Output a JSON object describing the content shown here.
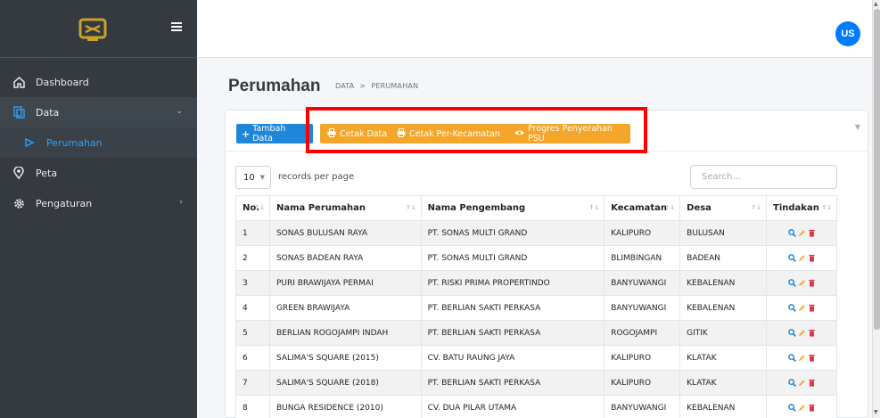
{
  "sidebar": {
    "items": [
      {
        "label": "Dashboard",
        "icon": "home-icon"
      },
      {
        "label": "Data",
        "icon": "database-icon"
      },
      {
        "label": "Perumahan",
        "icon": "circle-icon"
      },
      {
        "label": "Peta",
        "icon": "map-pin-icon"
      },
      {
        "label": "Pengaturan",
        "icon": "gear-icon"
      }
    ]
  },
  "user": {
    "initials": "US"
  },
  "page": {
    "title": "Perumahan",
    "breadcrumb": [
      "DATA",
      "PERUMAHAN"
    ]
  },
  "toolbar": {
    "add_label": "Tambah Data",
    "print_label": "Cetak Data",
    "print_district_label": "Cetak Per-Kecamatan",
    "progress_label": "Progres Penyerahan PSU"
  },
  "datatable": {
    "page_length": "10",
    "length_label": "records per page",
    "search_placeholder": "Search..."
  },
  "table": {
    "headers": [
      "No.",
      "Nama Perumahan",
      "Nama Pengembang",
      "Kecamatan",
      "Desa",
      "Tindakan"
    ],
    "rows": [
      [
        "1",
        "SONAS BULUSAN RAYA",
        "PT. SONAS MULTI GRAND",
        "KALIPURO",
        "BULUSAN"
      ],
      [
        "2",
        "SONAS BADEAN RAYA",
        "PT. SONAS MULTI GRAND",
        "BLIMBINGAN",
        "BADEAN"
      ],
      [
        "3",
        "PURI BRAWIJAYA PERMAI",
        "PT. RISKI PRIMA PROPERTINDO",
        "BANYUWANGI",
        "KEBALENAN"
      ],
      [
        "4",
        "GREEN BRAWIJAYA",
        "PT. BERLIAN SAKTI PERKASA",
        "BANYUWANGI",
        "KEBALENAN"
      ],
      [
        "5",
        "BERLIAN ROGOJAMPI INDAH",
        "PT. BERLIAN SAKTI PERKASA",
        "ROGOJAMPI",
        "GITIK"
      ],
      [
        "6",
        "SALIMA'S SQUARE (2015)",
        "CV. BATU RAUNG JAYA",
        "KALIPURO",
        "KLATAK"
      ],
      [
        "7",
        "SALIMA'S SQUARE (2018)",
        "PT. BERLIAN SAKTI PERKASA",
        "KALIPURO",
        "KLATAK"
      ],
      [
        "8",
        "BUNGA RESIDENCE (2010)",
        "CV. DUA PILAR UTAMA",
        "BANYUWANGI",
        "KEBALENAN"
      ]
    ]
  },
  "colors": {
    "primary": "#1f86d9",
    "warning": "#f4a62a",
    "danger": "#dc3545",
    "highlight": "#ff0000"
  }
}
